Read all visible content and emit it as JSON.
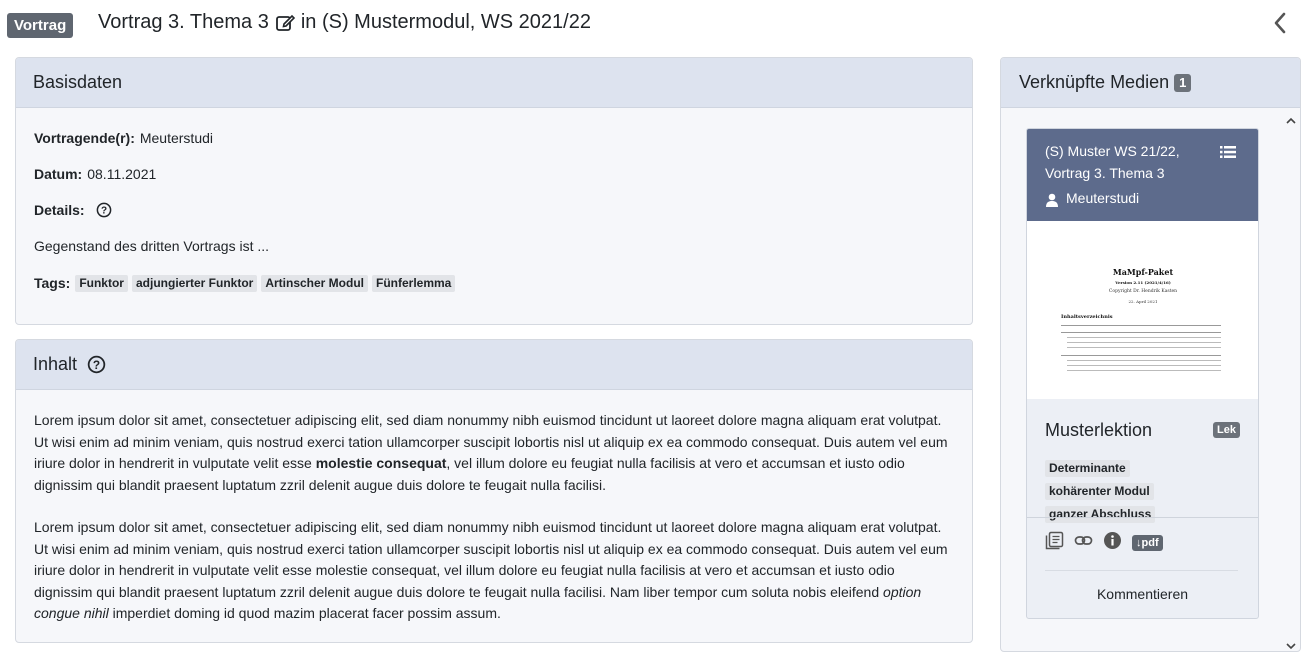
{
  "header": {
    "type_badge": "Vortrag",
    "title_before": "Vortrag 3. Thema 3",
    "title_after": "in (S) Mustermodul, WS 2021/22"
  },
  "basisdaten": {
    "title": "Basisdaten",
    "speaker_label": "Vortragende(r):",
    "speaker": "Meuterstudi",
    "date_label": "Datum:",
    "date": "08.11.2021",
    "details_label": "Details:",
    "description": "Gegenstand des dritten Vortrags ist ...",
    "tags_label": "Tags:",
    "tags": [
      "Funktor",
      "adjungierter Funktor",
      "Artinscher Modul",
      "Fünferlemma"
    ]
  },
  "inhalt": {
    "title": "Inhalt",
    "p1_a": "Lorem ipsum dolor sit amet, consectetuer adipiscing elit, sed diam nonummy nibh euismod tincidunt ut laoreet dolore magna aliquam erat volutpat. Ut wisi enim ad minim veniam, quis nostrud exerci tation ullamcorper suscipit lobortis nisl ut aliquip ex ea commodo consequat. Duis autem vel eum iriure dolor in hendrerit in vulputate velit esse ",
    "p1_bold": "molestie consequat",
    "p1_b": ", vel illum dolore eu feugiat nulla facilisis at vero et accumsan et iusto odio dignissim qui blandit praesent luptatum zzril delenit augue duis dolore te feugait nulla facilisi.",
    "p2_a": "Lorem ipsum dolor sit amet, consectetuer adipiscing elit, sed diam nonummy nibh euismod tincidunt ut laoreet dolore magna aliquam erat volutpat. Ut wisi enim ad minim veniam, quis nostrud exerci tation ullamcorper suscipit lobortis nisl ut aliquip ex ea commodo consequat. Duis autem vel eum iriure dolor in hendrerit in vulputate velit esse molestie consequat, vel illum dolore eu feugiat nulla facilisis at vero et accumsan et iusto odio dignissim qui blandit praesent luptatum zzril delenit augue duis dolore te feugait nulla facilisi. Nam liber tempor cum soluta nobis eleifend ",
    "p2_italic": "option congue nihil",
    "p2_b": " imperdiet doming id quod mazim placerat facer possim assum."
  },
  "media": {
    "title": "Verknüpfte Medien",
    "count": "1",
    "item": {
      "head_line1": "(S) Muster WS 21/22,",
      "head_line2": "Vortrag 3. Thema 3",
      "user": "Meuterstudi",
      "doc_title": "MaMpf-Paket",
      "doc_version": "Version 2.11 (2021/4/16)",
      "doc_copyright": "Copyright Dr. Hendrik Kasten",
      "doc_date": "22. April 2021",
      "doc_toc": "Inhaltsverzeichnis",
      "lesson_title": "Musterlektion",
      "lesson_badge": "Lek",
      "tags": [
        "Determinante",
        "kohärenter Modul",
        "ganzer Abschluss"
      ],
      "pdf_label": "↓pdf",
      "comment_label": "Kommentieren"
    }
  },
  "colors": {
    "card_header_bg": "#dde3ef",
    "media_head_bg": "#5d6b8c",
    "badge_bg": "#5f6670"
  }
}
